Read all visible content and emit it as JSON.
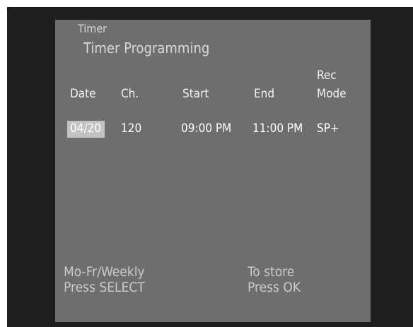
{
  "breadcrumb": "Timer",
  "title": "Timer Programming",
  "columns": {
    "date": "Date",
    "channel": "Ch.",
    "start": "Start",
    "end": "End",
    "rec_mode_line1": "Rec",
    "rec_mode_line2": "Mode"
  },
  "rows": [
    {
      "date": "04/20",
      "channel": "120",
      "start": "09:00 PM",
      "end": "11:00 PM",
      "rec_mode": "SP+"
    }
  ],
  "hints": {
    "left_line1": "Mo-Fr/Weekly",
    "left_line2": "Press SELECT",
    "right_line1": "To store",
    "right_line2": "Press OK"
  },
  "colors": {
    "outer_background": "#1e1e1e",
    "menu_background": "#6e6e6e",
    "selection_highlight": "#c2c2c2",
    "text": "#f2f2f2"
  }
}
